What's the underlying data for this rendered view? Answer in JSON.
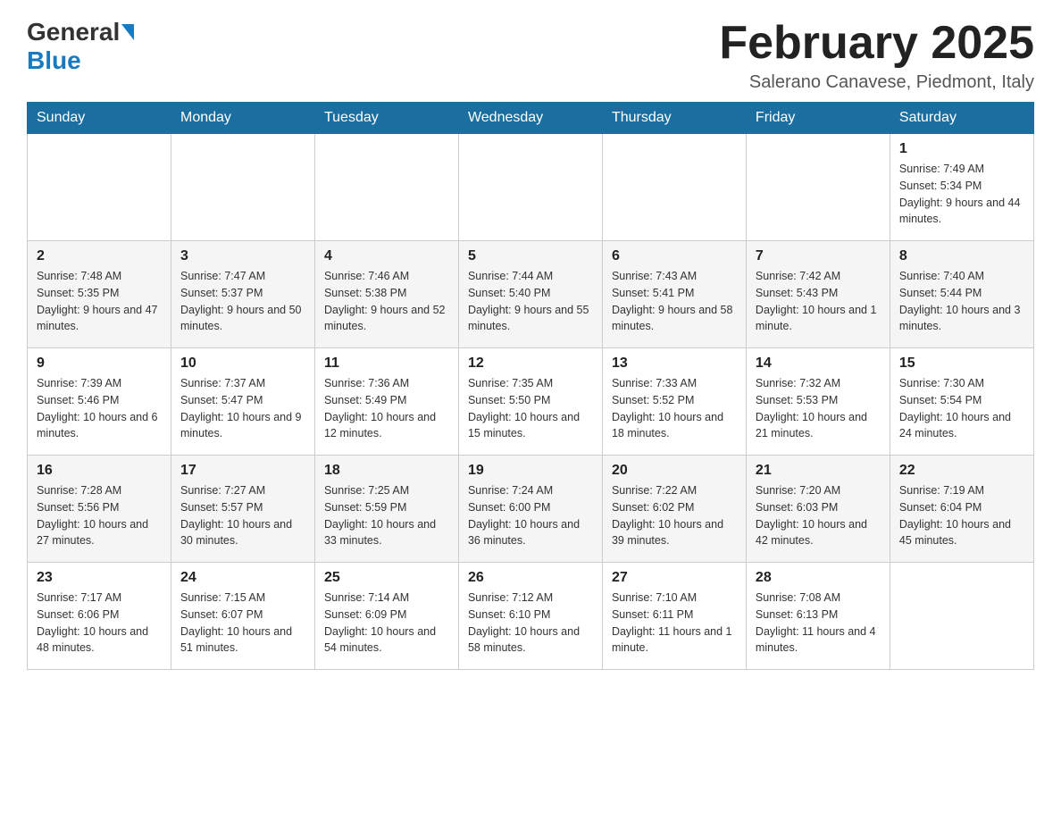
{
  "header": {
    "logo_general": "General",
    "logo_blue": "Blue",
    "month_title": "February 2025",
    "location": "Salerano Canavese, Piedmont, Italy"
  },
  "days_of_week": [
    "Sunday",
    "Monday",
    "Tuesday",
    "Wednesday",
    "Thursday",
    "Friday",
    "Saturday"
  ],
  "weeks": [
    [
      {
        "day": "",
        "info": ""
      },
      {
        "day": "",
        "info": ""
      },
      {
        "day": "",
        "info": ""
      },
      {
        "day": "",
        "info": ""
      },
      {
        "day": "",
        "info": ""
      },
      {
        "day": "",
        "info": ""
      },
      {
        "day": "1",
        "info": "Sunrise: 7:49 AM\nSunset: 5:34 PM\nDaylight: 9 hours and 44 minutes."
      }
    ],
    [
      {
        "day": "2",
        "info": "Sunrise: 7:48 AM\nSunset: 5:35 PM\nDaylight: 9 hours and 47 minutes."
      },
      {
        "day": "3",
        "info": "Sunrise: 7:47 AM\nSunset: 5:37 PM\nDaylight: 9 hours and 50 minutes."
      },
      {
        "day": "4",
        "info": "Sunrise: 7:46 AM\nSunset: 5:38 PM\nDaylight: 9 hours and 52 minutes."
      },
      {
        "day": "5",
        "info": "Sunrise: 7:44 AM\nSunset: 5:40 PM\nDaylight: 9 hours and 55 minutes."
      },
      {
        "day": "6",
        "info": "Sunrise: 7:43 AM\nSunset: 5:41 PM\nDaylight: 9 hours and 58 minutes."
      },
      {
        "day": "7",
        "info": "Sunrise: 7:42 AM\nSunset: 5:43 PM\nDaylight: 10 hours and 1 minute."
      },
      {
        "day": "8",
        "info": "Sunrise: 7:40 AM\nSunset: 5:44 PM\nDaylight: 10 hours and 3 minutes."
      }
    ],
    [
      {
        "day": "9",
        "info": "Sunrise: 7:39 AM\nSunset: 5:46 PM\nDaylight: 10 hours and 6 minutes."
      },
      {
        "day": "10",
        "info": "Sunrise: 7:37 AM\nSunset: 5:47 PM\nDaylight: 10 hours and 9 minutes."
      },
      {
        "day": "11",
        "info": "Sunrise: 7:36 AM\nSunset: 5:49 PM\nDaylight: 10 hours and 12 minutes."
      },
      {
        "day": "12",
        "info": "Sunrise: 7:35 AM\nSunset: 5:50 PM\nDaylight: 10 hours and 15 minutes."
      },
      {
        "day": "13",
        "info": "Sunrise: 7:33 AM\nSunset: 5:52 PM\nDaylight: 10 hours and 18 minutes."
      },
      {
        "day": "14",
        "info": "Sunrise: 7:32 AM\nSunset: 5:53 PM\nDaylight: 10 hours and 21 minutes."
      },
      {
        "day": "15",
        "info": "Sunrise: 7:30 AM\nSunset: 5:54 PM\nDaylight: 10 hours and 24 minutes."
      }
    ],
    [
      {
        "day": "16",
        "info": "Sunrise: 7:28 AM\nSunset: 5:56 PM\nDaylight: 10 hours and 27 minutes."
      },
      {
        "day": "17",
        "info": "Sunrise: 7:27 AM\nSunset: 5:57 PM\nDaylight: 10 hours and 30 minutes."
      },
      {
        "day": "18",
        "info": "Sunrise: 7:25 AM\nSunset: 5:59 PM\nDaylight: 10 hours and 33 minutes."
      },
      {
        "day": "19",
        "info": "Sunrise: 7:24 AM\nSunset: 6:00 PM\nDaylight: 10 hours and 36 minutes."
      },
      {
        "day": "20",
        "info": "Sunrise: 7:22 AM\nSunset: 6:02 PM\nDaylight: 10 hours and 39 minutes."
      },
      {
        "day": "21",
        "info": "Sunrise: 7:20 AM\nSunset: 6:03 PM\nDaylight: 10 hours and 42 minutes."
      },
      {
        "day": "22",
        "info": "Sunrise: 7:19 AM\nSunset: 6:04 PM\nDaylight: 10 hours and 45 minutes."
      }
    ],
    [
      {
        "day": "23",
        "info": "Sunrise: 7:17 AM\nSunset: 6:06 PM\nDaylight: 10 hours and 48 minutes."
      },
      {
        "day": "24",
        "info": "Sunrise: 7:15 AM\nSunset: 6:07 PM\nDaylight: 10 hours and 51 minutes."
      },
      {
        "day": "25",
        "info": "Sunrise: 7:14 AM\nSunset: 6:09 PM\nDaylight: 10 hours and 54 minutes."
      },
      {
        "day": "26",
        "info": "Sunrise: 7:12 AM\nSunset: 6:10 PM\nDaylight: 10 hours and 58 minutes."
      },
      {
        "day": "27",
        "info": "Sunrise: 7:10 AM\nSunset: 6:11 PM\nDaylight: 11 hours and 1 minute."
      },
      {
        "day": "28",
        "info": "Sunrise: 7:08 AM\nSunset: 6:13 PM\nDaylight: 11 hours and 4 minutes."
      },
      {
        "day": "",
        "info": ""
      }
    ]
  ]
}
